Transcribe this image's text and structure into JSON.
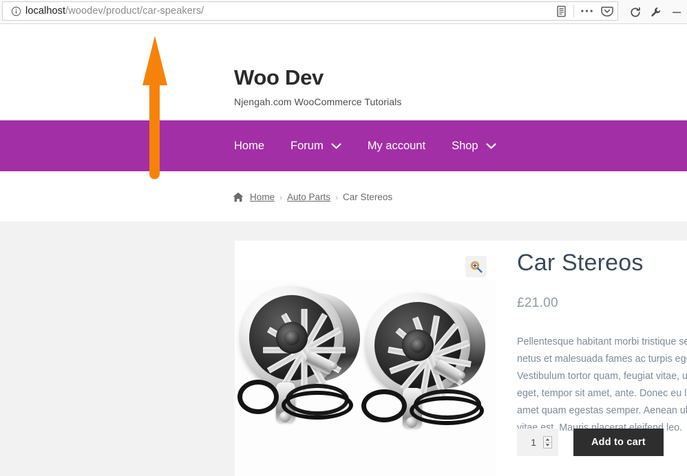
{
  "browser": {
    "identity_icon": "info-icon",
    "url_host": "localhost",
    "url_path": "/woodev/product/car-speakers/",
    "url_full": "localhost/woodev/product/car-speakers/",
    "toolbar": {
      "reader_mode": "reader-mode-icon",
      "page_actions": "ellipsis-icon",
      "pocket": "pocket-icon",
      "reload": "reload-icon",
      "devtools": "wrench-icon",
      "minimize": "minimize-icon"
    }
  },
  "site": {
    "title": "Woo Dev",
    "tagline": "Njengah.com WooCommerce Tutorials"
  },
  "nav": {
    "items": [
      {
        "label": "Home",
        "has_dropdown": false
      },
      {
        "label": "Forum",
        "has_dropdown": true
      },
      {
        "label": "My account",
        "has_dropdown": false
      },
      {
        "label": "Shop",
        "has_dropdown": true
      }
    ]
  },
  "breadcrumb": {
    "home_icon": "home-icon",
    "items": [
      {
        "label": "Home",
        "link": true
      },
      {
        "label": "Auto Parts",
        "link": true
      },
      {
        "label": "Car Stereos",
        "link": false
      }
    ],
    "separator": "›"
  },
  "product": {
    "title": "Car Stereos",
    "price": "£21.00",
    "description": "Pellentesque habitant morbi tristique senectus et netus et malesuada fames ac turpis egestas. Vestibulum tortor quam, feugiat vitae, ultricies eget, tempor sit amet, ante. Donec eu libero sit amet quam egestas semper. Aenean ultricies mi vitae est. Mauris placerat eleifend leo.",
    "zoom_icon": "zoom-in-icon",
    "image_alt": "car-speakers-pair",
    "quantity": "1",
    "quantity_up_icon": "spinner-up-icon",
    "quantity_down_icon": "spinner-down-icon",
    "add_to_cart_label": "Add to cart"
  },
  "annotation": {
    "arrow": "up-arrow-annotation",
    "color": "#F7820A"
  },
  "colors": {
    "nav_purple": "#A22FA5",
    "page_background": "#F2F2F2",
    "card_background": "#FFFFFF",
    "button_dark": "#2E2E2E",
    "price_text": "#8D9AA6",
    "title_text": "#3A4A5A"
  }
}
